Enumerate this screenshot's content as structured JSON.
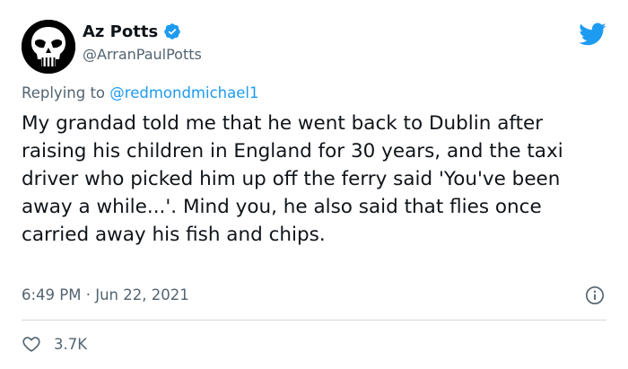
{
  "author": {
    "display_name": "Az Potts",
    "handle": "@ArranPaulPotts",
    "avatar_icon": "punisher-skull-icon",
    "verified": true
  },
  "reply": {
    "prefix": "Replying to ",
    "mention": "@redmondmichael1"
  },
  "tweet": {
    "text": "My grandad told me that he went back to Dublin after raising his children in England for 30 years, and the taxi driver who picked him up off the ferry said 'You've been away a while...'. Mind you, he also said that flies once carried away his fish and chips."
  },
  "meta": {
    "timestamp": "6:49 PM · Jun 22, 2021"
  },
  "actions": {
    "like_count": "3.7K"
  },
  "colors": {
    "accent": "#1d9bf0",
    "secondary_text": "#536471",
    "primary_text": "#0f1419",
    "divider": "#cfd9de"
  }
}
